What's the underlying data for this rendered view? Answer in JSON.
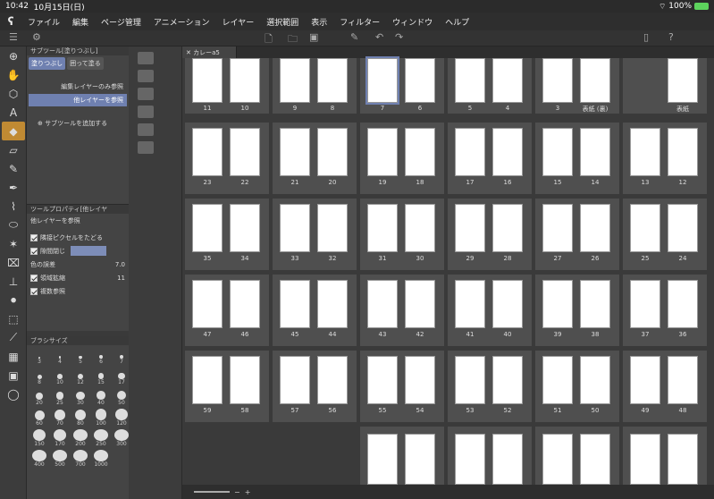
{
  "status": {
    "time": "10:42",
    "date": "10月15日(日)",
    "battery": "100%"
  },
  "menu": [
    "ファイル",
    "編集",
    "ページ管理",
    "アニメーション",
    "レイヤー",
    "選択範囲",
    "表示",
    "フィルター",
    "ウィンドウ",
    "ヘルプ"
  ],
  "tools": [
    "⊕",
    "✋",
    "⬡",
    "A",
    "◆",
    "▱",
    "✎",
    "✒",
    "⌇",
    "⬭",
    "✶",
    "⌧",
    "⊥",
    "⚫",
    "⬚",
    "⟋",
    "▦",
    "▣",
    "◯"
  ],
  "subtool": {
    "header": "サブツール[塗りつぶし]",
    "tabs": [
      "塗りつぶし",
      "囲って塗る"
    ],
    "items": [
      "編集レイヤーのみ参照",
      "他レイヤーを参照"
    ],
    "add": "サブツールを追加する"
  },
  "toolprop": {
    "header": "ツールプロパティ[他レイヤ",
    "name": "他レイヤーを参照",
    "p1": "隣接ピクセルをたどる",
    "p2": "隙間閉じ",
    "p3": "色の誤差",
    "p3val": "7.0",
    "p4": "領域拡縮",
    "p4val": "11",
    "p5": "複数参照"
  },
  "brush": {
    "header": "ブラシサイズ",
    "sizes": [
      "3",
      "4",
      "5",
      "6",
      "7",
      "8",
      "10",
      "12",
      "15",
      "17",
      "20",
      "25",
      "30",
      "40",
      "50",
      "60",
      "70",
      "80",
      "100",
      "120",
      "150",
      "170",
      "200",
      "250",
      "300",
      "400",
      "500",
      "700",
      "1000"
    ]
  },
  "doc": {
    "tab": "カレーa5"
  },
  "pages": [
    [
      "11",
      "10",
      "9",
      "8",
      "7",
      "6",
      "5",
      "4",
      "3",
      "表紙 (裏)",
      "",
      "表紙"
    ],
    [
      "23",
      "22",
      "21",
      "20",
      "19",
      "18",
      "17",
      "16",
      "15",
      "14",
      "13",
      "12"
    ],
    [
      "35",
      "34",
      "33",
      "32",
      "31",
      "30",
      "29",
      "28",
      "27",
      "26",
      "25",
      "24"
    ],
    [
      "47",
      "46",
      "45",
      "44",
      "43",
      "42",
      "41",
      "40",
      "39",
      "38",
      "37",
      "36"
    ],
    [
      "59",
      "58",
      "57",
      "56",
      "55",
      "54",
      "53",
      "52",
      "51",
      "50",
      "49",
      "48"
    ]
  ],
  "bottom": {
    "minus": "−",
    "plus": "+"
  }
}
